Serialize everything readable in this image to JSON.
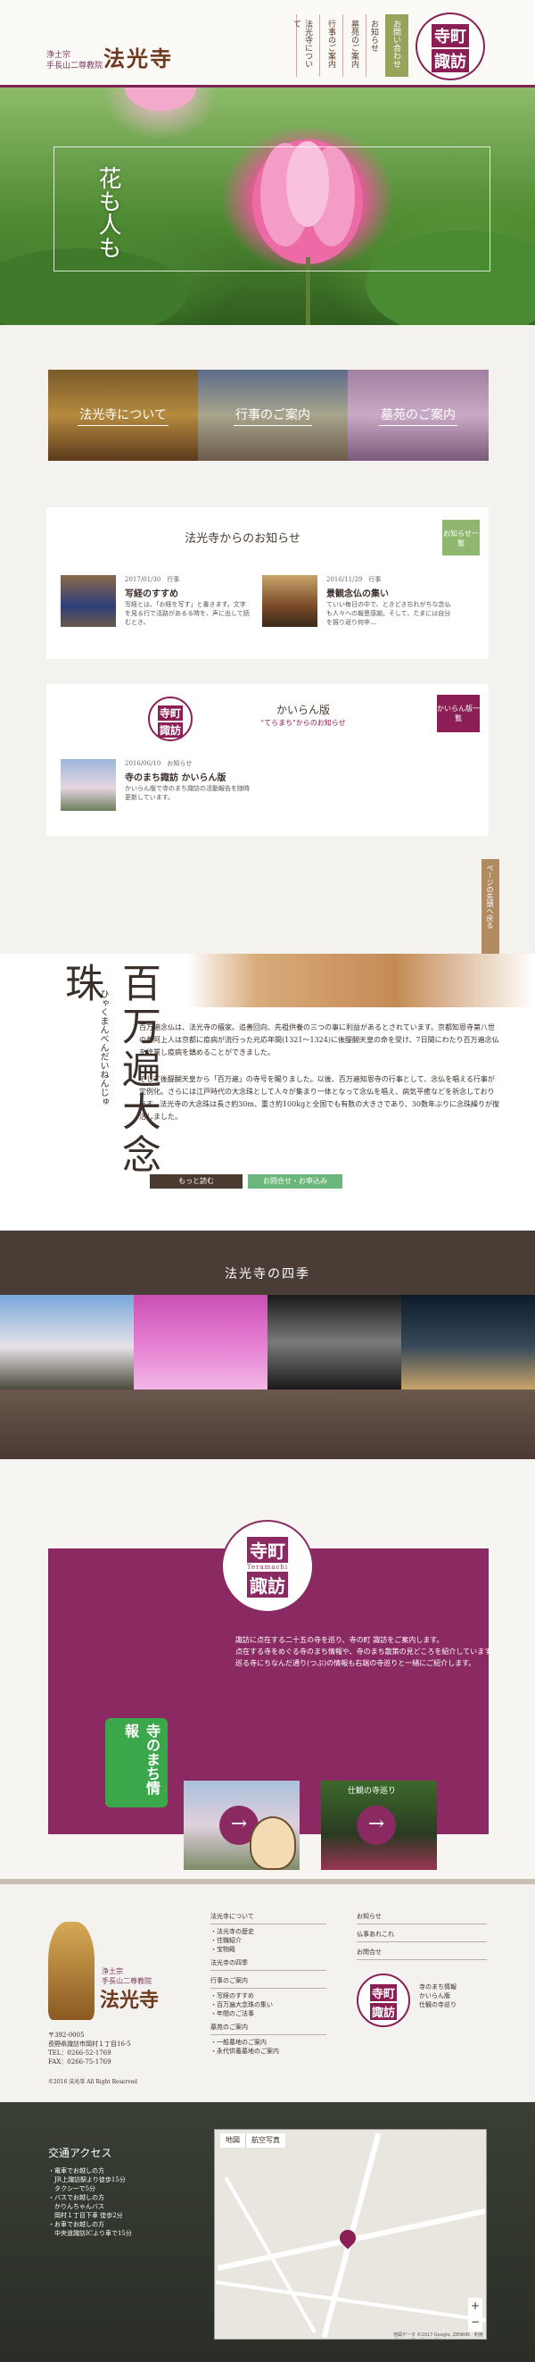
{
  "header": {
    "logo_sub_line1": "浄土宗",
    "logo_sub_line2": "手長山二尊教院",
    "logo_main": "法光寺",
    "nav": [
      "法光寺について",
      "行事のご案内",
      "墓苑のご案内",
      "お知らせ"
    ],
    "nav_contact": "お問い合わせ",
    "badge_line1": "寺町",
    "badge_line2": "諏訪"
  },
  "hero": {
    "copy": "花も人も"
  },
  "tiles": {
    "about": "法光寺について",
    "events": "行事のご案内",
    "grave": "墓苑のご案内"
  },
  "notice": {
    "title": "法光寺からのお知らせ",
    "more": "お知らせ一覧",
    "items": [
      {
        "meta": "2017/01/30　行事",
        "title": "写経のすすめ",
        "desc": "写経とは、「お経を写す」と書きます。文字を見る行で活路があるる時を、声に出して読むとき、"
      },
      {
        "meta": "2016/11/29　行事",
        "title": "景観念仏の集い",
        "desc": "ていい毎日の中で、ときどき忘れがちな念仏も人々への報恩感謝。そして、たまには自分を振り返り何卒…"
      }
    ]
  },
  "kairan": {
    "badge_line1": "寺町",
    "badge_line2": "諏訪",
    "title": "かいらん版",
    "sub": "\"てらまち\"からのお知らせ",
    "more": "かいらん版一覧",
    "item": {
      "meta": "2016/06/10　お知らせ",
      "title": "寺のまち諏訪 かいらん版",
      "desc": "かいらん版で寺のまち諏訪の活動報告を随時更新しています。"
    }
  },
  "side_tab": "ページの先頭へ戻る",
  "feature": {
    "kanji": "百万遍大念珠",
    "ruby": "ひゃくまんべんだいねんじゅ",
    "text1": "百万遍念仏は、法光寺の檀家。追善回向、先祖供養の三つの事に利益があるとされています。京都知恩寺第八世の善阿上人は京都に疫病が流行った元応年間(1321〜1324)に後醍醐天皇の命を受け、7日間にわたり百万遍念仏を修業し疫病を鎮めることができました。",
    "text2": "そして後醍醐天皇から「百万遍」の寺号を賜りました。以後、百万遍知恩寺の行事として、念仏を唱える行事が定例化。さらには江戸時代の大念珠として人々が集まり一体となって念仏を唱え、病気平癒などを祈念しております。法光寺の大念珠は長さ約30m、重さ約100kgと全国でも有数の大きさであり、30数年ぶりに念珠繰りが復活しました。",
    "btn_more": "もっと読む",
    "btn_apply": "お問合せ・お申込み"
  },
  "seasons": {
    "title": "法光寺の四季"
  },
  "teramachi": {
    "badge_line1": "寺町",
    "badge_line2": "諏訪",
    "badge_en": "Teramachi",
    "desc": "諏訪に点在する二十五の寺を巡り、寺の町 諏訪をご案内します。\n点在する寺をめぐる寺のまち情報や、寺のまち散策の見どころを紹介しています。\n巡る寺にちなんだ通り(つぶ)の情報も右端の寺巡りと一緒にご紹介します。",
    "logo_text": "寺のまち情報",
    "card_tour": "仕観の寺巡り",
    "arrow": "→"
  },
  "footer": {
    "sub_line1": "浄土宗",
    "sub_line2": "手長山二尊教院",
    "name": "法光寺",
    "address": "〒392-0005\n長野県諏訪市岡村１丁目16-5\nTEL：0266-52-1769\nFAX：0266-75-1769",
    "copyright": "©2016 法光寺 All Right Reserved",
    "col1": {
      "h1": "法光寺について",
      "i1": [
        "・法光寺の歴史",
        "・住職紹介",
        "・宝物殿"
      ],
      "h2": "法光寺の四季",
      "h3": "行事のご案内",
      "i3": [
        "・写経のすすめ",
        "・百万遍大念珠の集い",
        "・年間のご法事"
      ]
    },
    "col2": {
      "h1": "墓苑のご案内",
      "i1": [
        "・一般墓地のご案内",
        "・永代供養墓地のご案内"
      ]
    },
    "col3": {
      "h1": "お知らせ",
      "h2": "仏事あれこれ",
      "h3": "お問合せ"
    },
    "badge_line1": "寺町",
    "badge_line2": "諏訪",
    "links": [
      "寺のまち情報",
      "かいらん版",
      "仕観の寺巡り"
    ]
  },
  "access": {
    "title": "交通アクセス",
    "text": "・電車でお越しの方\n　JR上諏訪駅より徒歩15分\n　タクシーで5分\n・バスでお越しの方\n　かりんちゃんバス\n　岡村１丁目下車 徒歩2分\n・お車でお越しの方\n　中央道諏訪ICより車で15分",
    "map_tab1": "地図",
    "map_tab2": "航空写真",
    "map_footer": "地図データ ©2017 Google, ZENRIN　利用規約　地図の誤りを報告する",
    "zoom_in": "+",
    "zoom_out": "−"
  }
}
